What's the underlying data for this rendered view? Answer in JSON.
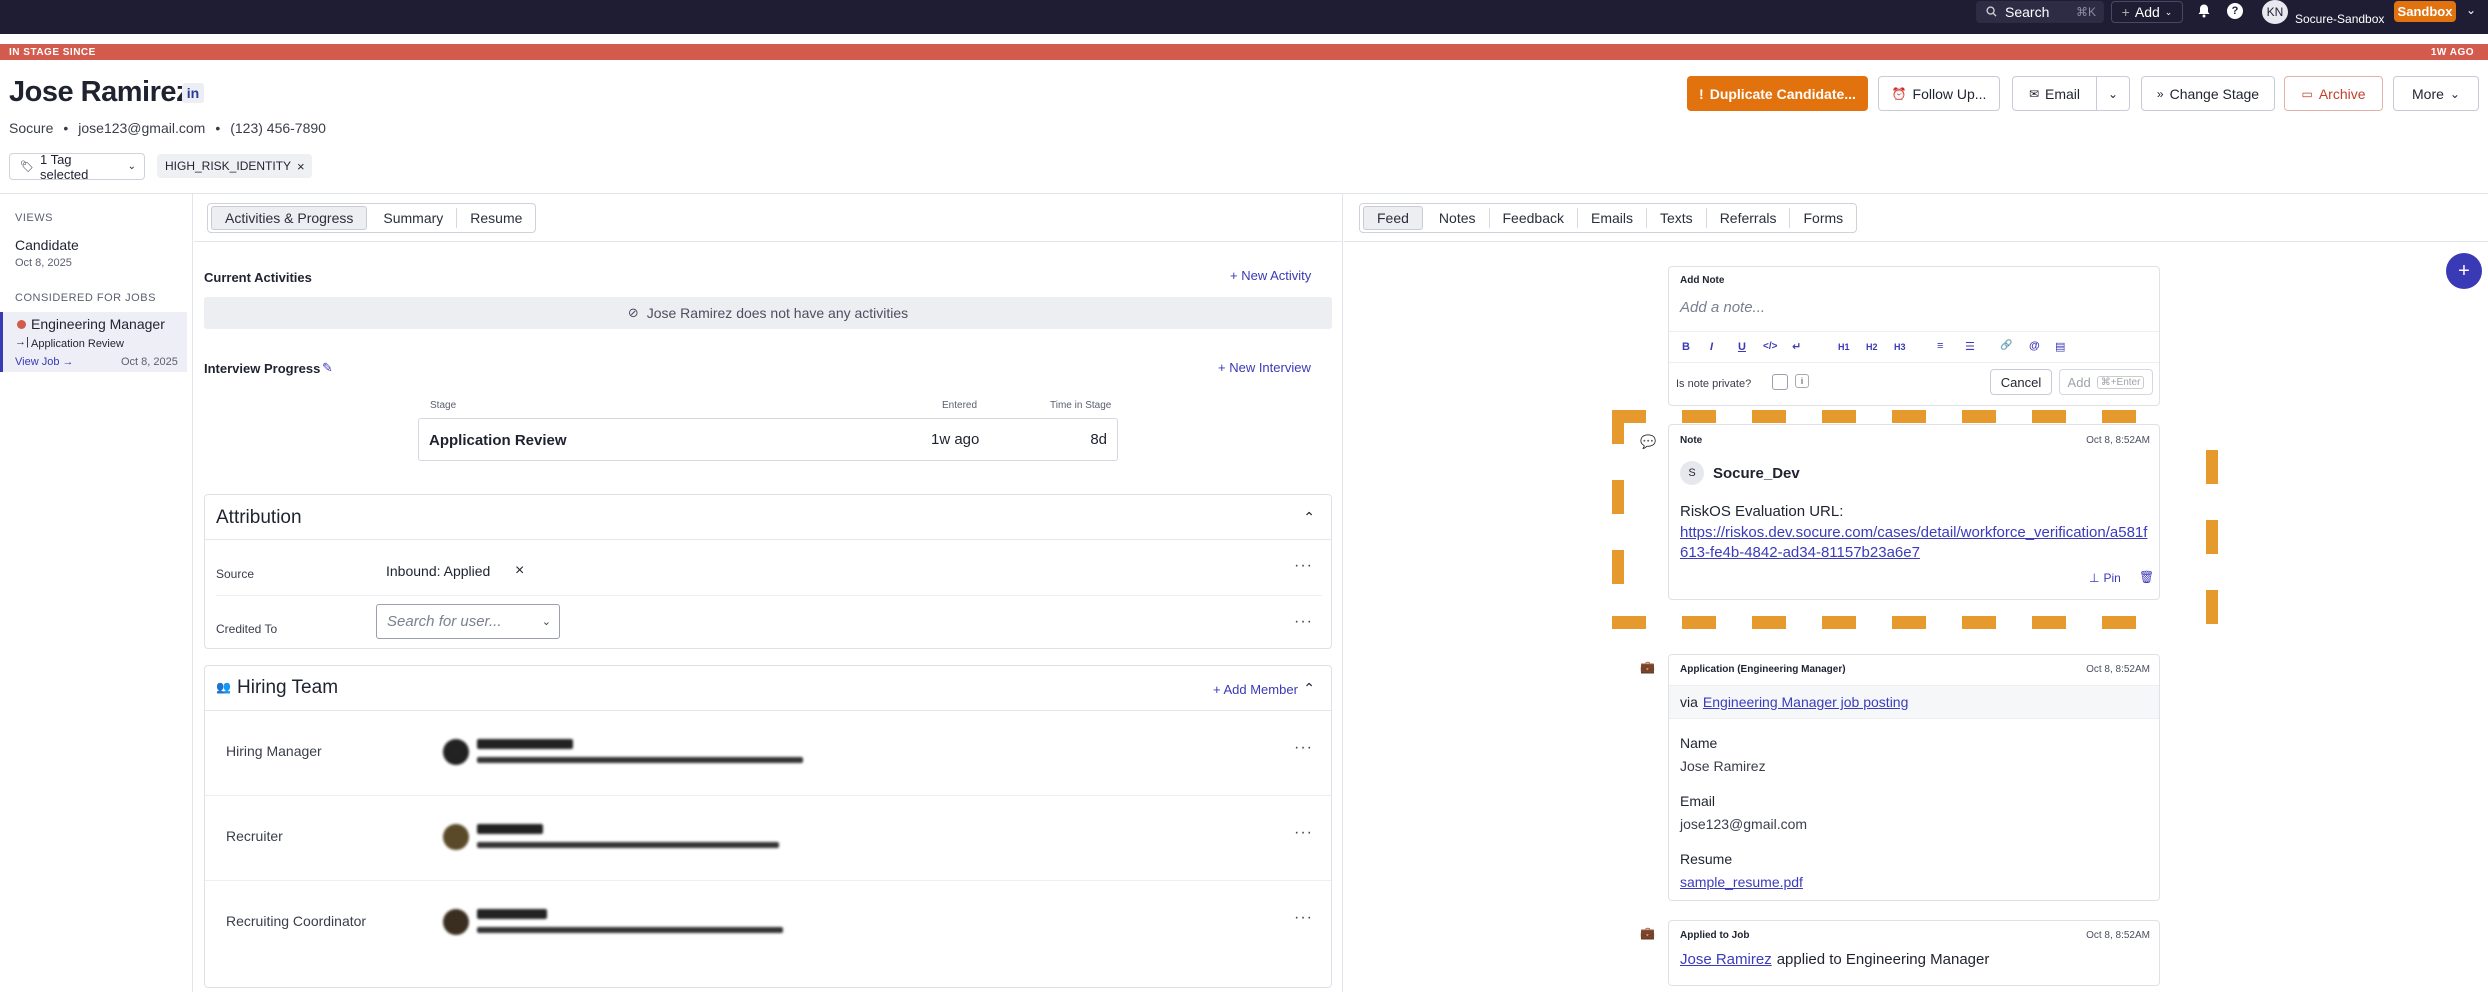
{
  "topbar": {
    "search_label": "Search",
    "search_shortcut": "⌘K",
    "add_label": "Add",
    "avatar_initials": "KN",
    "org_name": "Socure-Sandbox",
    "env_badge": "Sandbox"
  },
  "stage_banner": {
    "left": "IN STAGE SINCE",
    "right": "1W AGO"
  },
  "candidate": {
    "name": "Jose Ramirez",
    "linkedin": "in",
    "company": "Socure",
    "email": "jose123@gmail.com",
    "phone": "(123) 456-7890",
    "tag_selector": "1 Tag selected",
    "tags": [
      "HIGH_RISK_IDENTITY"
    ]
  },
  "actions": {
    "duplicate": "Duplicate Candidate...",
    "follow_up": "Follow Up...",
    "email": "Email",
    "change_stage": "Change Stage",
    "archive": "Archive",
    "more": "More"
  },
  "sidebar": {
    "views_heading": "VIEWS",
    "view_name": "Candidate",
    "view_date": "Oct 8, 2025",
    "jobs_heading": "CONSIDERED FOR JOBS",
    "job_title": "Engineering Manager",
    "job_stage": "Application Review",
    "view_job": "View Job →",
    "job_date": "Oct 8, 2025"
  },
  "left_tabs": [
    "Activities & Progress",
    "Summary",
    "Resume"
  ],
  "right_tabs": [
    "Feed",
    "Notes",
    "Feedback",
    "Emails",
    "Texts",
    "Referrals",
    "Forms"
  ],
  "activities": {
    "heading": "Current Activities",
    "new_activity": "+ New Activity",
    "empty": "Jose Ramirez does not have any activities"
  },
  "interview": {
    "heading": "Interview Progress",
    "new_interview": "+ New Interview",
    "col_stage": "Stage",
    "col_entered": "Entered",
    "col_time": "Time in Stage",
    "stage": "Application Review",
    "entered": "1w ago",
    "time": "8d"
  },
  "attribution": {
    "heading": "Attribution",
    "source_label": "Source",
    "source_value": "Inbound: Applied",
    "credited_label": "Credited To",
    "credited_placeholder": "Search for user..."
  },
  "hiring_team": {
    "heading": "Hiring Team",
    "add_member": "+ Add Member",
    "rows": [
      {
        "role": "Hiring Manager"
      },
      {
        "role": "Recruiter"
      },
      {
        "role": "Recruiting Coordinator"
      }
    ]
  },
  "add_note": {
    "heading": "Add Note",
    "placeholder": "Add a note...",
    "private_label": "Is note private?",
    "cancel": "Cancel",
    "add": "Add",
    "add_shortcut": "⌘+Enter",
    "toolbar": [
      "B",
      "I",
      "U",
      "</>",
      "↵",
      "H1",
      "H2",
      "H3",
      "≡",
      "☰",
      "🔗",
      "@",
      "▤"
    ]
  },
  "note_item": {
    "type": "Note",
    "date": "Oct 8, 8:52AM",
    "author_initial": "S",
    "author": "Socure_Dev",
    "text": "RiskOS Evaluation URL:",
    "url_line1": "https://riskos.dev.socure.com/cases/detail/workforce_verification/a581f",
    "url_line2": "613-fe4b-4842-ad34-81157b23a6e7",
    "pin": "Pin"
  },
  "application_item": {
    "type": "Application (Engineering Manager)",
    "date": "Oct 8, 8:52AM",
    "via": "via",
    "via_link": "Engineering Manager job posting",
    "name_label": "Name",
    "name_value": "Jose Ramirez",
    "email_label": "Email",
    "email_value": "jose123@gmail.com",
    "resume_label": "Resume",
    "resume_value": "sample_resume.pdf"
  },
  "applied_item": {
    "type": "Applied to Job",
    "date": "Oct 8, 8:52AM",
    "who": "Jose Ramirez",
    "text": "applied to Engineering Manager"
  },
  "colors": {
    "accent": "#3a39b6",
    "orange": "#e2720e",
    "banner": "#d35b4d",
    "topbar": "#1f1d33"
  }
}
